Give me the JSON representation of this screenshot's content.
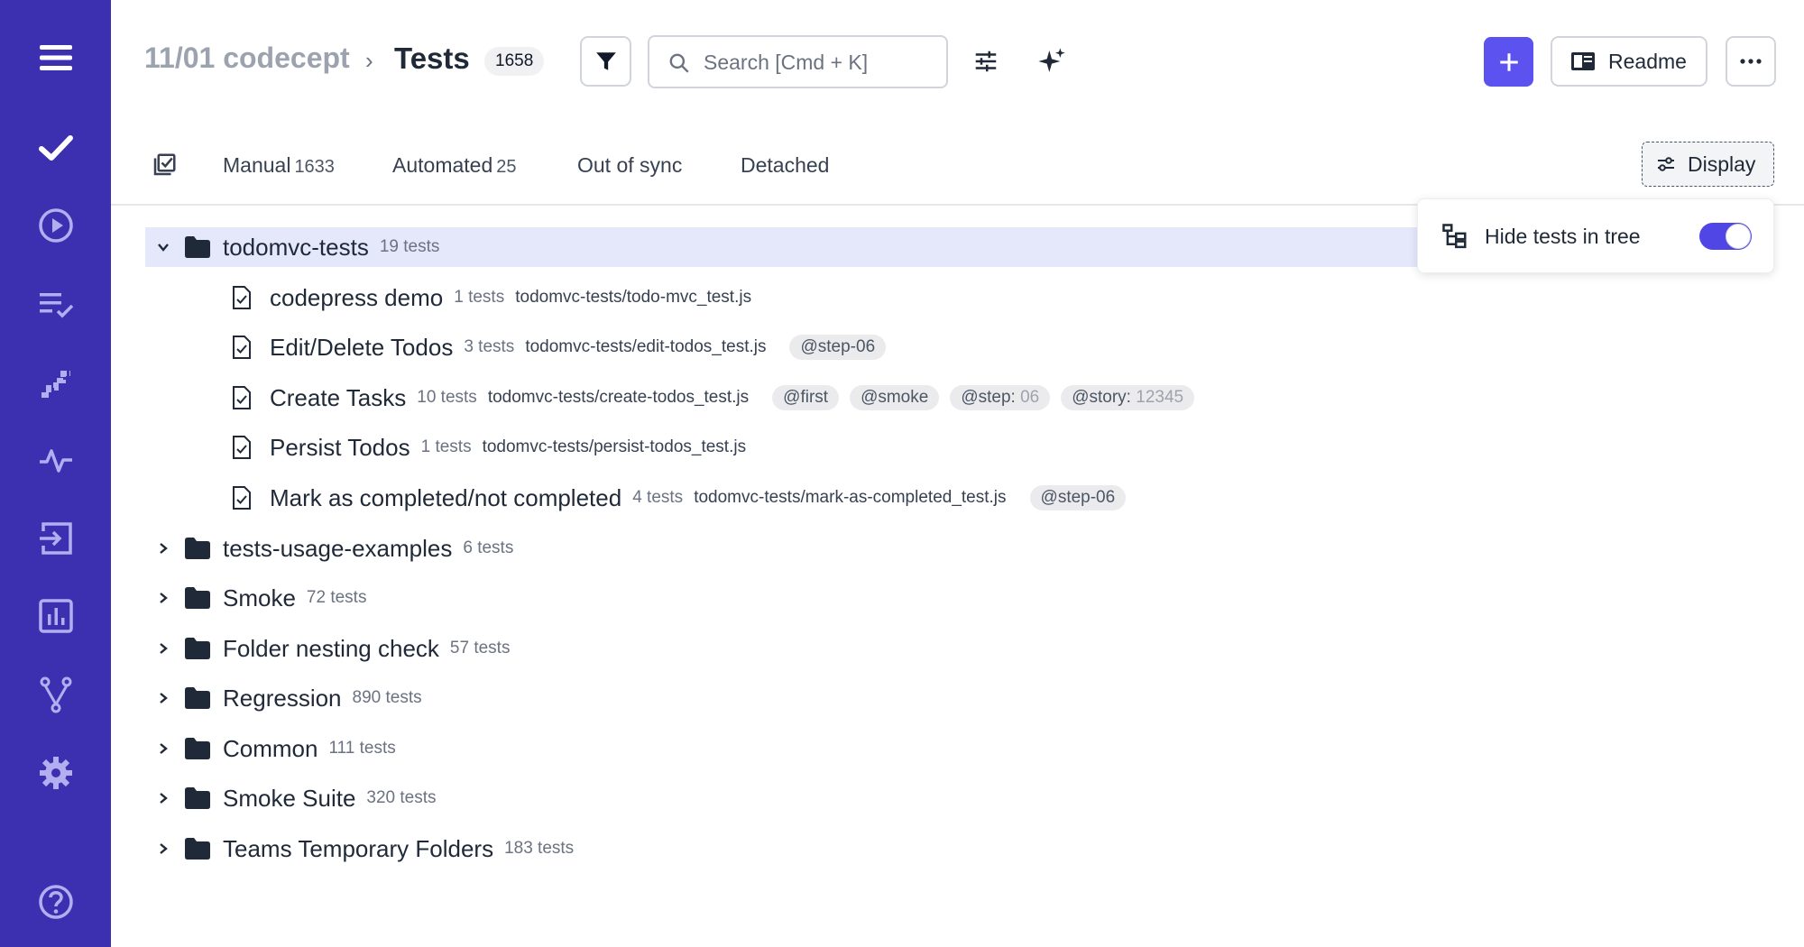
{
  "sidebar": {
    "items": [
      {
        "name": "menu-icon"
      },
      {
        "name": "tests-check-icon"
      },
      {
        "name": "runs-play-icon"
      },
      {
        "name": "plans-list-check-icon"
      },
      {
        "name": "steps-stairs-icon"
      },
      {
        "name": "pulse-icon"
      },
      {
        "name": "import-icon"
      },
      {
        "name": "analytics-icon"
      },
      {
        "name": "branches-icon"
      },
      {
        "name": "settings-gear-icon"
      },
      {
        "name": "help-icon"
      }
    ],
    "colors": {
      "background": "#3c2fb0",
      "icon": "#ffffff",
      "icon_muted": "#b3aef0"
    }
  },
  "header": {
    "project": "11/01 codecept",
    "separator": "›",
    "title": "Tests",
    "count": "1658",
    "search_placeholder": "Search [Cmd + K]",
    "readme_label": "Readme"
  },
  "tabs": [
    {
      "label": "Manual",
      "count": "1633"
    },
    {
      "label": "Automated",
      "count": "25"
    },
    {
      "label": "Out of sync",
      "count": ""
    },
    {
      "label": "Detached",
      "count": ""
    }
  ],
  "display_label": "Display",
  "popover": {
    "label": "Hide tests in tree",
    "toggle_on": true
  },
  "tree": {
    "open_folder": {
      "name": "todomvc-tests",
      "count": "19 tests"
    },
    "files": [
      {
        "name": "codepress demo",
        "count": "1 tests",
        "path": "todomvc-tests/todo-mvc_test.js",
        "tags": []
      },
      {
        "name": "Edit/Delete Todos",
        "count": "3 tests",
        "path": "todomvc-tests/edit-todos_test.js",
        "tags": [
          {
            "k": "@step-06",
            "v": ""
          }
        ]
      },
      {
        "name": "Create Tasks",
        "count": "10 tests",
        "path": "todomvc-tests/create-todos_test.js",
        "tags": [
          {
            "k": "@first",
            "v": ""
          },
          {
            "k": "@smoke",
            "v": ""
          },
          {
            "k": "@step:",
            "v": "06"
          },
          {
            "k": "@story:",
            "v": "12345"
          }
        ]
      },
      {
        "name": "Persist Todos",
        "count": "1 tests",
        "path": "todomvc-tests/persist-todos_test.js",
        "tags": []
      },
      {
        "name": "Mark as completed/not completed",
        "count": "4 tests",
        "path": "todomvc-tests/mark-as-completed_test.js",
        "tags": [
          {
            "k": "@step-06",
            "v": ""
          }
        ]
      }
    ],
    "folders": [
      {
        "name": "tests-usage-examples",
        "count": "6 tests"
      },
      {
        "name": "Smoke",
        "count": "72 tests"
      },
      {
        "name": "Folder nesting check",
        "count": "57 tests"
      },
      {
        "name": "Regression",
        "count": "890 tests"
      },
      {
        "name": "Common",
        "count": "111 tests"
      },
      {
        "name": "Smoke Suite",
        "count": "320 tests"
      },
      {
        "name": "Teams Temporary Folders",
        "count": "183 tests"
      }
    ]
  }
}
